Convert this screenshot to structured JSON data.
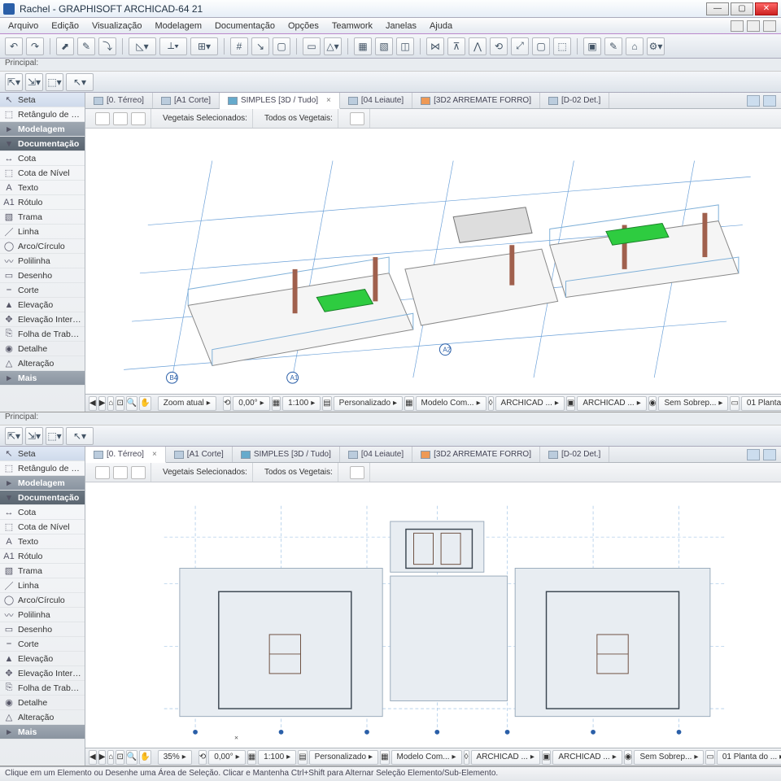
{
  "window": {
    "title": "Rachel - GRAPHISOFT ARCHICAD-64 21"
  },
  "menu": [
    "Arquivo",
    "Edição",
    "Visualização",
    "Modelagem",
    "Documentação",
    "Opções",
    "Teamwork",
    "Janelas",
    "Ajuda"
  ],
  "principal_label": "Principal:",
  "toolbox": {
    "arrow": "Seta",
    "marquee": "Retângulo de Se...",
    "section_model": "Modelagem",
    "section_doc": "Documentação",
    "items": [
      {
        "icon": "↔",
        "label": "Cota"
      },
      {
        "icon": "⬚",
        "label": "Cota de Nível"
      },
      {
        "icon": "A",
        "label": "Texto"
      },
      {
        "icon": "A1",
        "label": "Rótulo"
      },
      {
        "icon": "▧",
        "label": "Trama"
      },
      {
        "icon": "／",
        "label": "Linha"
      },
      {
        "icon": "◯",
        "label": "Arco/Círculo"
      },
      {
        "icon": "〰",
        "label": "Polilinha"
      },
      {
        "icon": "▭",
        "label": "Desenho"
      },
      {
        "icon": "⎯",
        "label": "Corte"
      },
      {
        "icon": "▲",
        "label": "Elevação"
      },
      {
        "icon": "✥",
        "label": "Elevação Interior"
      },
      {
        "icon": "⎘",
        "label": "Folha de Trabalho"
      },
      {
        "icon": "◉",
        "label": "Detalhe"
      },
      {
        "icon": "△",
        "label": "Alteração"
      }
    ],
    "more": "Mais"
  },
  "tabs": [
    {
      "label": "[0. Térreo]",
      "icon": "plan",
      "closable": true
    },
    {
      "label": "[A1 Corte]",
      "icon": "section"
    },
    {
      "label": "SIMPLES [3D / Tudo]",
      "icon": "3d",
      "closable": true,
      "active": true
    },
    {
      "label": "[04 Leiaute]",
      "icon": "layout"
    },
    {
      "label": "[3D2 ARREMATE FORRO]",
      "icon": "3d2"
    },
    {
      "label": "[D-02 Det.]",
      "icon": "detail"
    }
  ],
  "tabs2_active": 0,
  "infobar": {
    "veg_sel": "Vegetais Selecionados:",
    "veg_all": "Todos os Vegetais:"
  },
  "quickbar": {
    "zoom1": "Zoom atual",
    "zoom2": "35%",
    "angle": "0,00°",
    "scale": "1:100",
    "pers": "Personalizado",
    "model": "Modelo Com...",
    "arch1": "ARCHICAD ...",
    "arch2": "ARCHICAD ...",
    "sem": "Sem Sobrep...",
    "planta": "01 Planta do ..."
  },
  "status": "Clique em um Elemento ou Desenhe uma Área de Seleção. Clicar e Mantenha Ctrl+Shift para Alternar Seleção Elemento/Sub-Elemento."
}
